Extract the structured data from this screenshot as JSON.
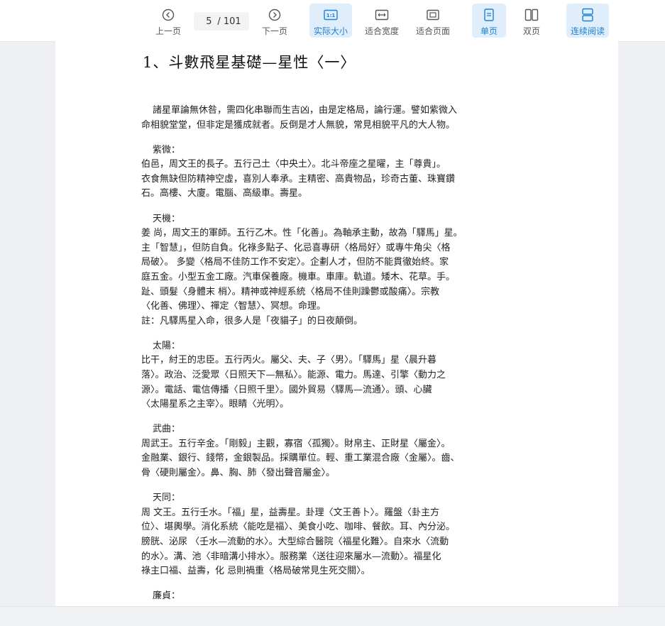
{
  "toolbar": {
    "prev_label": "上一页",
    "page_current": "5",
    "page_total": "/ 101",
    "next_label": "下一页",
    "actual_size_label": "实际大小",
    "fit_width_label": "适合宽度",
    "fit_page_label": "适合页面",
    "single_page_label": "单页",
    "double_page_label": "双页",
    "continuous_label": "连续阅读",
    "accent_color": "#1e7fd6"
  },
  "document": {
    "title": "1、斗數飛星基礎—星性〈一〉",
    "intro": [
      "諸星單論無休咎，需四化串聯而生吉凶，由是定格局，論行運。譬如紫微入",
      "命相貌堂堂，但非定是獲成就者。反倒是才人無貌，常見相貌平凡的大人物。"
    ],
    "sections": [
      {
        "heading": "紫微：",
        "lines": [
          "伯邑，周文王的長子。五行己土〈中央土〉。北斗帝座之星曜，主「尊貴」。",
          "衣食無缺但防精神空虛，喜別人奉承。主精密、高貴物品，珍奇古董、珠寶鑽",
          "石。高樓、大廈。電腦、高級車。壽星。"
        ]
      },
      {
        "heading": "天機：",
        "lines": [
          "姜 尚，周文王的軍師。五行乙木。性「化善」。為軸承主動，故為「驛馬」星。",
          "主「智慧」，但防自負。化祿多點子、化忌喜專研〈格局好〉或專牛角尖〈格",
          "局破〉。 多變〈格局不佳防工作不安定〉。企劃人才，但防不能貫徹始終。家",
          "庭五金。小型五金工廠。汽車保養廠。機車。車庫。軌道。矮木、花草。手。",
          "趾、頭髮〈身體末 梢〉。精神或神經系統〈格局不佳則躁鬱或酸痛〉。宗教",
          "〈化善、佛理〉、禪定〈智慧〉、冥想。命理。",
          "註：凡驛馬星入命，很多人是「夜貓子」的日夜顛倒。"
        ]
      },
      {
        "heading": "太陽：",
        "lines": [
          "比干，紂王的忠臣。五行丙火。屬父、夫、子〈男〉。「驛馬」星〈晨升暮",
          "落〉。政治、泛愛眾〈日照天下—無私〉。能源、電力。馬達、引擎〈動力之",
          "源〉。電話、電信傳播〈日照千里〉。國外貿易〈驛馬—流通〉。頭、心臟",
          "〈太陽星系之主宰〉。眼睛〈光明〉。"
        ]
      },
      {
        "heading": "武曲：",
        "lines": [
          "周武王。五行辛金。「剛毅」主觀，寡宿〈孤獨〉。財帛主、正財星〈屬金〉。",
          "金融業、銀行、錢幣，金銀製品。採購單位。輕、重工業混合廠〈金屬〉。齒、",
          "骨〈硬則屬金〉。鼻、胸、肺〈發出聲音屬金〉。"
        ]
      },
      {
        "heading": "天同：",
        "lines": [
          "周 文王。五行壬水。「福」星，益壽星。卦理〈文王善卜〉。羅盤〈卦主方",
          "位〉、堪輿學。消化系統〈能吃是福〉、美食小吃、咖啡、餐飲。耳、內分泌。",
          "膀胱、泌尿 〈壬水—流動的水〉。大型綜合醫院〈福星化難〉。自來水〈流動",
          "的水〉。溝、池〈非暗溝小排水〉。服務業〈送往迎來屬水—流動〉。福星化",
          "祿主口福、益壽，化 忌則禍重〈格局破常見生死交關〉。"
        ]
      },
      {
        "heading": "廉貞：",
        "lines": []
      }
    ]
  }
}
